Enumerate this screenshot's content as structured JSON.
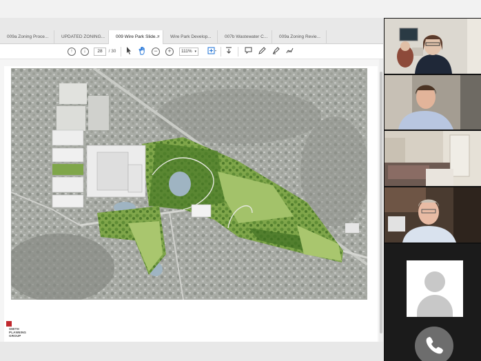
{
  "viewer": {
    "tabs": [
      {
        "label": "009a Zoning Proce..."
      },
      {
        "label": "UPDATED ZONING..."
      },
      {
        "label": "009 Wire Park Slide...",
        "close": "×"
      },
      {
        "label": "Wire Park Develop..."
      },
      {
        "label": "007b Wastewater C..."
      },
      {
        "label": "009a Zoning Revie..."
      }
    ],
    "toolbar": {
      "page_current": "28",
      "page_total": "/ 30",
      "zoom": "111%"
    }
  },
  "logo": {
    "line1": "SMITH",
    "line2": "PLANNING",
    "line3": "GROUP"
  },
  "colors": {
    "accent": "#1a6fd6",
    "logo_red": "#c0282d",
    "site_green": "#7fa64a"
  },
  "icons": [
    "up-arrow-circle-icon",
    "down-arrow-circle-icon",
    "pointer-icon",
    "hand-icon",
    "zoom-out-icon",
    "zoom-in-icon",
    "fit-page-icon",
    "download-icon",
    "comment-icon",
    "pen-icon",
    "highlight-icon",
    "sign-icon",
    "user-avatar-icon",
    "phone-icon"
  ]
}
